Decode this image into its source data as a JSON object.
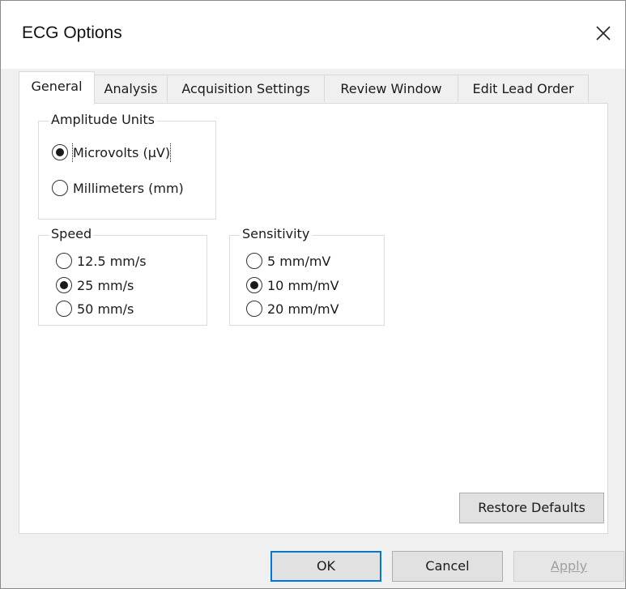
{
  "window": {
    "title": "ECG Options"
  },
  "tabs": [
    {
      "label": "General",
      "active": true
    },
    {
      "label": "Analysis",
      "active": false
    },
    {
      "label": "Acquisition Settings",
      "active": false
    },
    {
      "label": "Review Window",
      "active": false
    },
    {
      "label": "Edit Lead Order",
      "active": false
    }
  ],
  "amplitude_units": {
    "title": "Amplitude Units",
    "options": [
      {
        "label": "Microvolts (µV)",
        "selected": true
      },
      {
        "label": "Millimeters (mm)",
        "selected": false
      }
    ]
  },
  "speed": {
    "title": "Speed",
    "options": [
      {
        "label": "12.5 mm/s",
        "selected": false
      },
      {
        "label": "25 mm/s",
        "selected": true
      },
      {
        "label": "50 mm/s",
        "selected": false
      }
    ]
  },
  "sensitivity": {
    "title": "Sensitivity",
    "options": [
      {
        "label": "5 mm/mV",
        "selected": false
      },
      {
        "label": "10 mm/mV",
        "selected": true
      },
      {
        "label": "20 mm/mV",
        "selected": false
      }
    ]
  },
  "buttons": {
    "restore_defaults": "Restore Defaults",
    "ok": "OK",
    "cancel": "Cancel",
    "apply": "Apply"
  },
  "icons": {
    "close": "close-icon"
  },
  "colors": {
    "default_button_border": "#0078d7",
    "disabled_text": "#a0a0a0"
  }
}
